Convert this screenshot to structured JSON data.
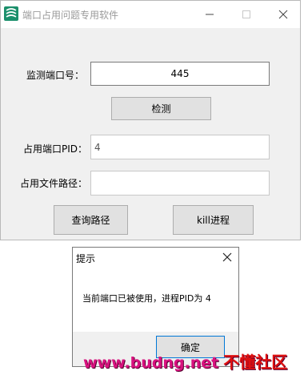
{
  "window": {
    "title": "端口占用问题专用软件",
    "controls": {
      "minimize": "minimize-icon",
      "maximize": "maximize-icon",
      "close": "close-icon"
    }
  },
  "form": {
    "port_label": "监测端口号：",
    "port_value": "445",
    "detect_button": "检测",
    "pid_label": "占用端口PID：",
    "pid_value": "4",
    "path_label": "占用文件路径：",
    "path_value": "",
    "query_button": "查询路径",
    "kill_button": "kill进程"
  },
  "dialog": {
    "title": "提示",
    "message": "当前端口已被使用，进程PID为 4",
    "ok_button": "确定"
  },
  "watermark": {
    "url": "www.budng.net",
    "name": "不懂社区"
  },
  "colors": {
    "accent": "#0078d7",
    "app_icon": "#1b8f6b",
    "watermark": "#d8127f"
  }
}
